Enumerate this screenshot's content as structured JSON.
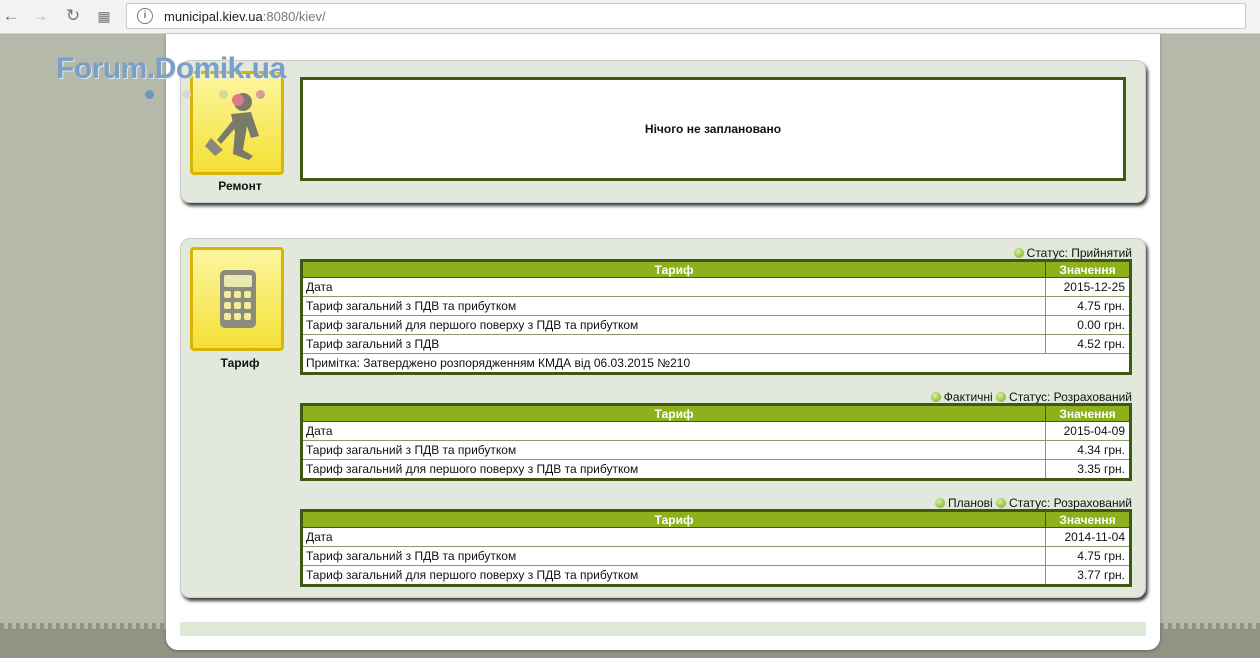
{
  "browser": {
    "url_host": "municipal.kiev.ua",
    "url_rest": ":8080/kiev/"
  },
  "watermark": {
    "text": "Forum.Domik.ua"
  },
  "repair": {
    "label": "Ремонт",
    "message": "Нічого не заплановано"
  },
  "tariff": {
    "label": "Тариф",
    "header_name": "Тариф",
    "header_value": "Значення",
    "blocks": [
      {
        "status_prefix": "",
        "status": "Статус: Прийнятий",
        "rows": [
          {
            "name": "Дата",
            "value": "2015-12-25"
          },
          {
            "name": "Тариф загальний з ПДВ та прибутком",
            "value": "4.75 грн."
          },
          {
            "name": "Тариф загальний для першого поверху з ПДВ та прибутком",
            "value": "0.00 грн."
          },
          {
            "name": "Тариф загальний з ПДВ",
            "value": "4.52 грн."
          }
        ],
        "note": "Примітка: Затверджено розпорядженням КМДА від 06.03.2015 №210"
      },
      {
        "status_prefix": "Фактичні",
        "status": "Статус: Розрахований",
        "rows": [
          {
            "name": "Дата",
            "value": "2015-04-09"
          },
          {
            "name": "Тариф загальний з ПДВ та прибутком",
            "value": "4.34 грн."
          },
          {
            "name": "Тариф загальний для першого поверху з ПДВ та прибутком",
            "value": "3.35 грн."
          }
        ]
      },
      {
        "status_prefix": "Планові",
        "status": "Статус: Розрахований",
        "rows": [
          {
            "name": "Дата",
            "value": "2014-11-04"
          },
          {
            "name": "Тариф загальний з ПДВ та прибутком",
            "value": "4.75 грн."
          },
          {
            "name": "Тариф загальний для першого поверху з ПДВ та прибутком",
            "value": "3.77 грн."
          }
        ]
      }
    ]
  }
}
